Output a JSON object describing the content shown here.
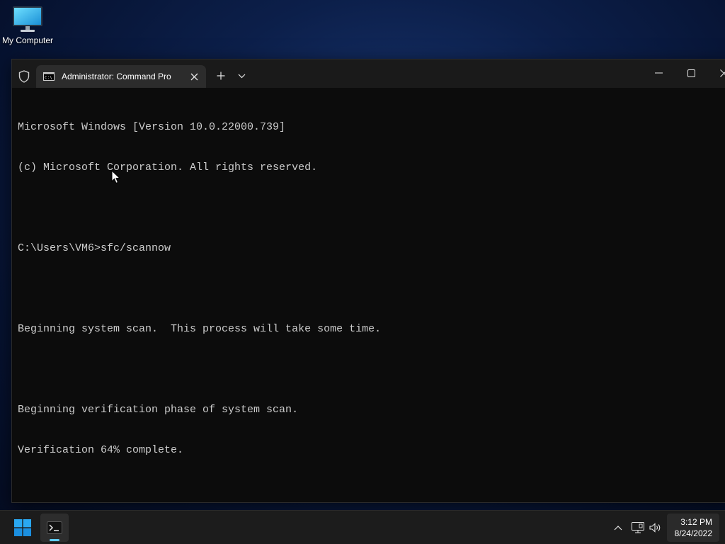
{
  "desktop": {
    "icons": [
      {
        "label": "My Computer",
        "icon": "monitor-icon"
      }
    ]
  },
  "terminal": {
    "tab_title": "Administrator: Command Pro",
    "tab_icon": "cmd-icon",
    "shield_icon": "shield-icon",
    "new_tab_icon": "plus-icon",
    "dropdown_icon": "chevron-down-icon",
    "controls": {
      "minimize_icon": "minimize-icon",
      "maximize_icon": "maximize-icon",
      "close_icon": "close-icon"
    },
    "lines": [
      "Microsoft Windows [Version 10.0.22000.739]",
      "(c) Microsoft Corporation. All rights reserved.",
      "",
      "C:\\Users\\VM6>sfc/scannow",
      "",
      "Beginning system scan.  This process will take some time.",
      "",
      "Beginning verification phase of system scan.",
      "Verification 64% complete."
    ]
  },
  "taskbar": {
    "start_icon": "windows-start-icon",
    "apps": [
      {
        "icon": "terminal-icon",
        "active": true
      }
    ],
    "tray": {
      "chevron_icon": "chevron-up-icon",
      "network_icon": "network-icon",
      "volume_icon": "volume-icon"
    },
    "clock": {
      "time": "3:12 PM",
      "date": "8/24/2022"
    }
  },
  "colors": {
    "console_background": "#0c0c0c",
    "console_text": "#cccccc",
    "titlebar": "#1a1a1a",
    "active_tab": "#2c2c2c",
    "taskbar": "#1c1c1c",
    "accent": "#60cdff"
  }
}
